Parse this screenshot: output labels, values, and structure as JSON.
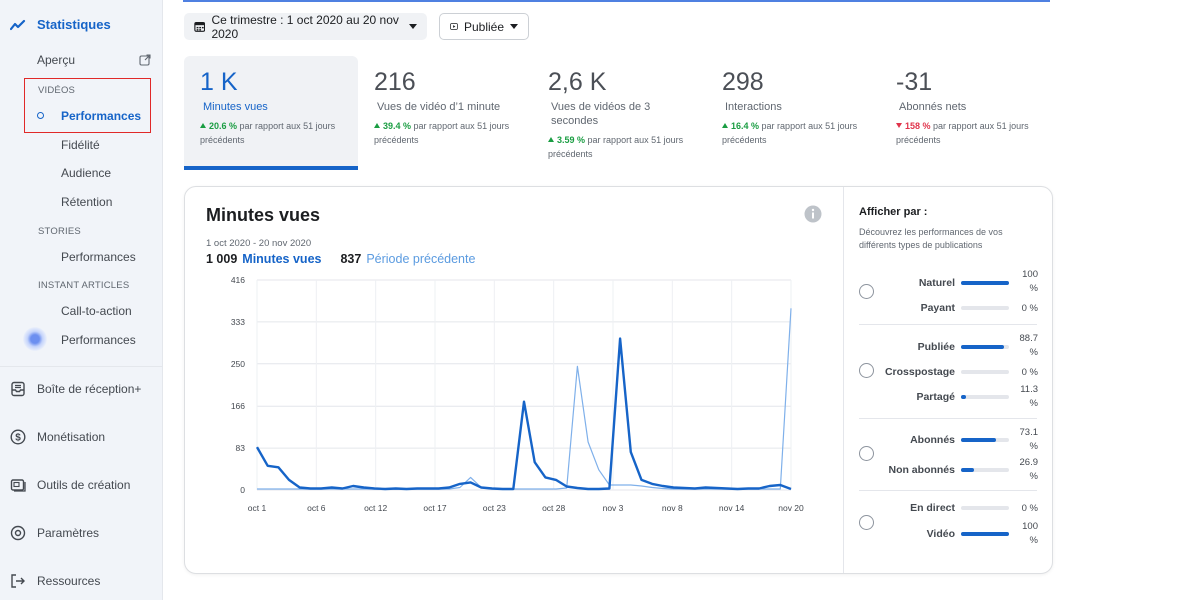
{
  "sidebar": {
    "title": "Statistiques",
    "apercu": "Aperçu",
    "videos_section": "VIDÉOS",
    "videos_items": [
      "Performances",
      "Fidélité",
      "Audience",
      "Rétention"
    ],
    "stories_section": "STORIES",
    "stories_items": [
      "Performances"
    ],
    "instant_section": "INSTANT ARTICLES",
    "instant_items": [
      "Call-to-action",
      "Performances"
    ],
    "main_items": [
      {
        "label": "Boîte de réception+",
        "icon": "inbox-icon"
      },
      {
        "label": "Monétisation",
        "icon": "dollar-icon"
      },
      {
        "label": "Outils de création",
        "icon": "creator-tools-icon"
      },
      {
        "label": "Paramètres",
        "icon": "gear-icon"
      },
      {
        "label": "Ressources",
        "icon": "resources-icon"
      }
    ]
  },
  "filters": {
    "date_range": "Ce trimestre : 1 oct 2020 au 20 nov 2020",
    "status": "Publiée"
  },
  "kpis": [
    {
      "value": "1 K",
      "label": "Minutes vues",
      "pct": "20.6 %",
      "trend": "up",
      "suffix": "par rapport aux 51 jours précédents"
    },
    {
      "value": "216",
      "label": "Vues de vidéo d’1 minute",
      "pct": "39.4 %",
      "trend": "up",
      "suffix": "par rapport aux 51 jours précédents"
    },
    {
      "value": "2,6 K",
      "label": "Vues de vidéos de 3 secondes",
      "pct": "3.59 %",
      "trend": "up",
      "suffix": "par rapport aux 51 jours précédents"
    },
    {
      "value": "298",
      "label": "Interactions",
      "pct": "16.4 %",
      "trend": "up",
      "suffix": "par rapport aux 51 jours précédents"
    },
    {
      "value": "-31",
      "label": "Abonnés nets",
      "pct": "158 %",
      "trend": "down",
      "suffix": "par rapport aux 51 jours précédents"
    }
  ],
  "chart": {
    "title": "Minutes vues",
    "range": "1 oct 2020 - 20 nov 2020",
    "current_value": "1 009",
    "current_label": "Minutes vues",
    "previous_value": "837",
    "previous_label": "Période précédente"
  },
  "chart_data": {
    "type": "line",
    "yticks": [
      0,
      83,
      166,
      250,
      333,
      416
    ],
    "ylim": [
      0,
      416
    ],
    "xticks": [
      "oct 1",
      "oct 6",
      "oct 12",
      "oct 17",
      "oct 23",
      "oct 28",
      "nov 3",
      "nov 8",
      "nov 14",
      "nov 20"
    ],
    "series": [
      {
        "name": "Minutes vues",
        "color": "#1664c8",
        "values": [
          85,
          48,
          45,
          20,
          5,
          3,
          3,
          5,
          3,
          8,
          5,
          3,
          2,
          3,
          2,
          3,
          3,
          3,
          5,
          12,
          15,
          5,
          3,
          2,
          2,
          175,
          55,
          25,
          20,
          7,
          4,
          2,
          2,
          3,
          300,
          75,
          20,
          12,
          8,
          5,
          4,
          3,
          5,
          4,
          3,
          2,
          3,
          3,
          8,
          10,
          2
        ]
      },
      {
        "name": "Période précédente",
        "color": "#7fb0ea",
        "values": [
          2,
          2,
          2,
          2,
          2,
          2,
          2,
          2,
          2,
          2,
          2,
          2,
          2,
          2,
          2,
          2,
          2,
          2,
          2,
          5,
          25,
          5,
          2,
          2,
          2,
          2,
          2,
          2,
          2,
          4,
          245,
          95,
          40,
          10,
          10,
          10,
          8,
          5,
          3,
          2,
          2,
          2,
          2,
          2,
          2,
          2,
          2,
          2,
          2,
          2,
          360
        ]
      }
    ]
  },
  "breakdown": {
    "title": "Afficher par :",
    "description": "Découvrez les performances de vos différents types de publications",
    "groups": [
      {
        "rows": [
          {
            "label": "Naturel",
            "value": 100,
            "pct": "100 %"
          },
          {
            "label": "Payant",
            "value": 0,
            "pct": "0 %"
          }
        ]
      },
      {
        "rows": [
          {
            "label": "Publiée",
            "value": 88.7,
            "pct": "88.7 %"
          },
          {
            "label": "Crosspostage",
            "value": 0,
            "pct": "0 %"
          },
          {
            "label": "Partagé",
            "value": 11.3,
            "pct": "11.3 %"
          }
        ]
      },
      {
        "rows": [
          {
            "label": "Abonnés",
            "value": 73.1,
            "pct": "73.1 %"
          },
          {
            "label": "Non abonnés",
            "value": 26.9,
            "pct": "26.9 %"
          }
        ]
      },
      {
        "rows": [
          {
            "label": "En direct",
            "value": 0,
            "pct": "0 %"
          },
          {
            "label": "Vidéo",
            "value": 100,
            "pct": "100 %"
          }
        ]
      }
    ]
  }
}
